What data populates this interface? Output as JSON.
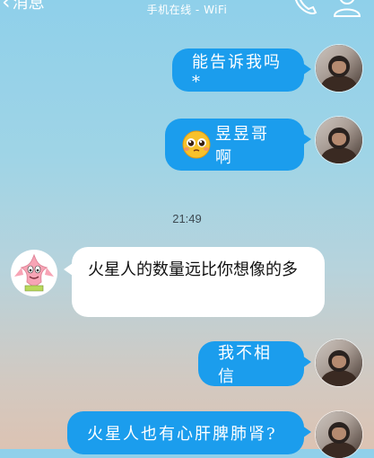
{
  "header": {
    "back_label": "消息",
    "subtitle": "手机在线 - WiFi"
  },
  "messages": [
    {
      "direction": "out",
      "text": "能告诉我吗*"
    },
    {
      "direction": "out",
      "emoji": "pleading-face-icon",
      "text": "昱昱哥啊"
    },
    {
      "direction": "timestamp",
      "text": "21:49"
    },
    {
      "direction": "in",
      "text": "火星人的数量远比你想像的多"
    },
    {
      "direction": "out",
      "text": "我不相信"
    },
    {
      "direction": "out",
      "text": "火星人也有心肝脾肺肾?"
    }
  ],
  "colors": {
    "outgoing_bubble": "#1b9ded",
    "incoming_bubble": "#ffffff",
    "header_text": "#ffffff"
  }
}
